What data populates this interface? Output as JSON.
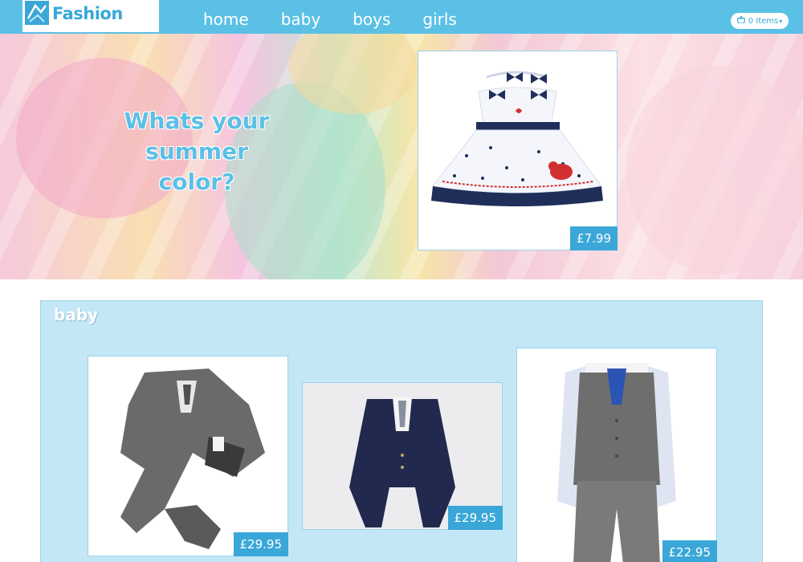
{
  "brand": {
    "logo_text": "Fashion"
  },
  "nav": {
    "links": [
      {
        "label": "home"
      },
      {
        "label": "baby"
      },
      {
        "label": "boys"
      },
      {
        "label": "girls"
      }
    ],
    "cart_label": "0 Items"
  },
  "hero": {
    "tagline": "Whats your summer color?",
    "featured_price": "£7.99"
  },
  "section": {
    "title": "baby",
    "products": [
      {
        "price": "£29.95"
      },
      {
        "price": "£29.95"
      },
      {
        "price": "£22.95"
      }
    ]
  },
  "colors": {
    "primary": "#5bc0e6",
    "accent": "#3aa7d8",
    "section_bg": "#c4e7f6"
  }
}
